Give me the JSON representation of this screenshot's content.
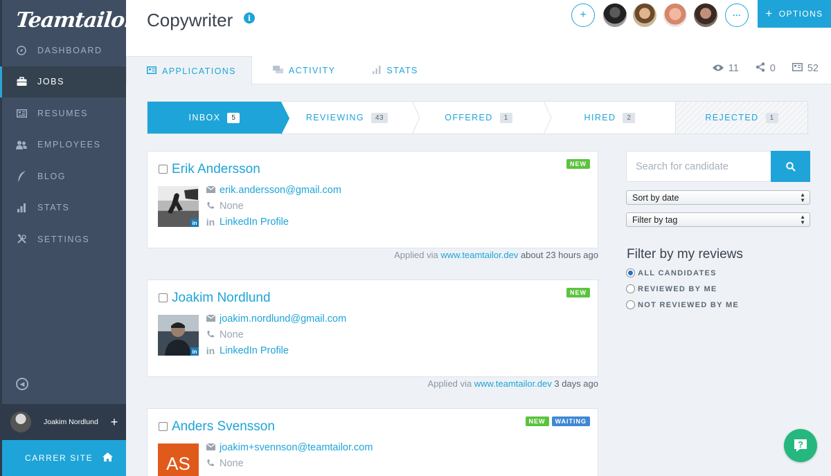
{
  "brand": {
    "logo": "Teamtailor",
    "accent": "#1ea4d8",
    "sidebar_bg": "#3f4e62"
  },
  "sidebar": {
    "items": [
      {
        "label": "DASHBOARD",
        "icon": "compass-icon"
      },
      {
        "label": "JOBS",
        "icon": "briefcase-icon",
        "active": true
      },
      {
        "label": "RESUMES",
        "icon": "id-card-icon"
      },
      {
        "label": "EMPLOYEES",
        "icon": "people-icon"
      },
      {
        "label": "BLOG",
        "icon": "quill-icon"
      },
      {
        "label": "STATS",
        "icon": "bar-chart-icon"
      },
      {
        "label": "SETTINGS",
        "icon": "tools-icon"
      }
    ],
    "user_name": "Joakim Nordlund",
    "user_plus": "+",
    "career_site": "CARRER SITE"
  },
  "header": {
    "title": "Copywriter",
    "info": "i",
    "add": "+",
    "more": "···",
    "options": "OPTIONS",
    "options_plus": "+",
    "tabs": [
      {
        "label": "APPLICATIONS",
        "icon": "id-card-icon",
        "active": true
      },
      {
        "label": "ACTIVITY",
        "icon": "chat-icon"
      },
      {
        "label": "STATS",
        "icon": "bar-chart-icon"
      }
    ],
    "stats": {
      "views": "11",
      "shares": "0",
      "applications": "52"
    }
  },
  "pipeline": [
    {
      "label": "INBOX",
      "count": "5",
      "active": true
    },
    {
      "label": "REVIEWING",
      "count": "43"
    },
    {
      "label": "OFFERED",
      "count": "1"
    },
    {
      "label": "HIRED",
      "count": "2"
    },
    {
      "label": "REJECTED",
      "count": "1"
    }
  ],
  "candidates": [
    {
      "name": "Erik Andersson",
      "email": "erik.andersson@gmail.com",
      "phone": "None",
      "linkedin": "LinkedIn Profile",
      "badges": [
        "NEW"
      ],
      "applied_prefix": "Applied via",
      "applied_site": "www.teamtailor.dev",
      "applied_time": "about 23 hours ago"
    },
    {
      "name": "Joakim Nordlund",
      "email": "joakim.nordlund@gmail.com",
      "phone": "None",
      "linkedin": "LinkedIn Profile",
      "badges": [
        "NEW"
      ],
      "applied_prefix": "Applied via",
      "applied_site": "www.teamtailor.dev",
      "applied_time": "3 days ago"
    },
    {
      "name": "Anders Svensson",
      "email": "joakim+svennson@teamtailor.com",
      "phone": "None",
      "initials": "AS",
      "badges": [
        "NEW",
        "WAITING"
      ]
    }
  ],
  "filters": {
    "search_placeholder": "Search for candidate",
    "sort": "Sort by date",
    "tag": "Filter by tag",
    "reviews_title": "Filter by my reviews",
    "options": [
      "ALL CANDIDATES",
      "REVIEWED BY ME",
      "NOT REVIEWED BY ME"
    ],
    "selected": "ALL CANDIDATES"
  },
  "help": "?",
  "li": "in"
}
